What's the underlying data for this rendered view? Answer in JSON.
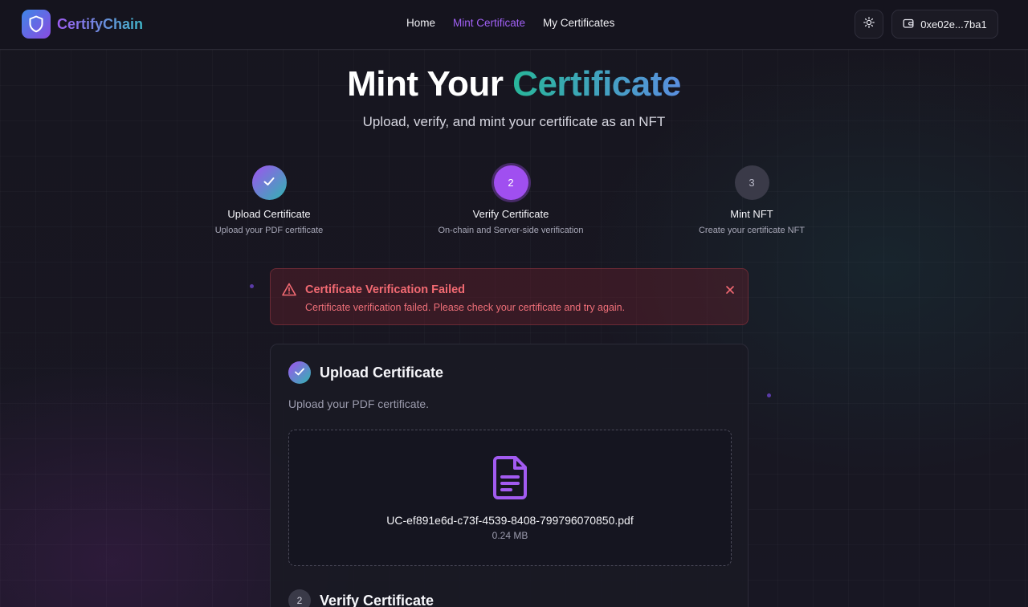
{
  "app": {
    "name": "CertifyChain"
  },
  "nav": {
    "items": [
      {
        "label": "Home",
        "active": false
      },
      {
        "label": "Mint Certificate",
        "active": true
      },
      {
        "label": "My Certificates",
        "active": false
      }
    ]
  },
  "header": {
    "theme_icon": "sun-icon",
    "wallet_icon": "wallet-icon",
    "wallet_address": "0xe02e...7ba1"
  },
  "hero": {
    "title_plain": "Mint Your",
    "title_highlight": "Certificate",
    "subtitle": "Upload, verify, and mint your certificate as an NFT"
  },
  "steps": [
    {
      "marker": "",
      "title": "Upload Certificate",
      "description": "Upload your PDF certificate",
      "state": "done"
    },
    {
      "marker": "2",
      "title": "Verify Certificate",
      "description": "On-chain and Server-side verification",
      "state": "current"
    },
    {
      "marker": "3",
      "title": "Mint NFT",
      "description": "Create your certificate NFT",
      "state": "pending"
    }
  ],
  "alert": {
    "icon": "warning-icon",
    "title": "Certificate Verification Failed",
    "message": "Certificate verification failed. Please check your certificate and try again."
  },
  "upload_section": {
    "title": "Upload Certificate",
    "description": "Upload your PDF certificate.",
    "file_icon": "file-text-icon",
    "file_name": "UC-ef891e6d-c73f-4539-8408-799796070850.pdf",
    "file_size": "0.24 MB"
  },
  "verify_section": {
    "number": "2",
    "title": "Verify Certificate"
  },
  "colors": {
    "accent_purple": "#a160f5",
    "accent_teal": "#28b69a",
    "error": "#f26a72",
    "background": "#14131d"
  }
}
